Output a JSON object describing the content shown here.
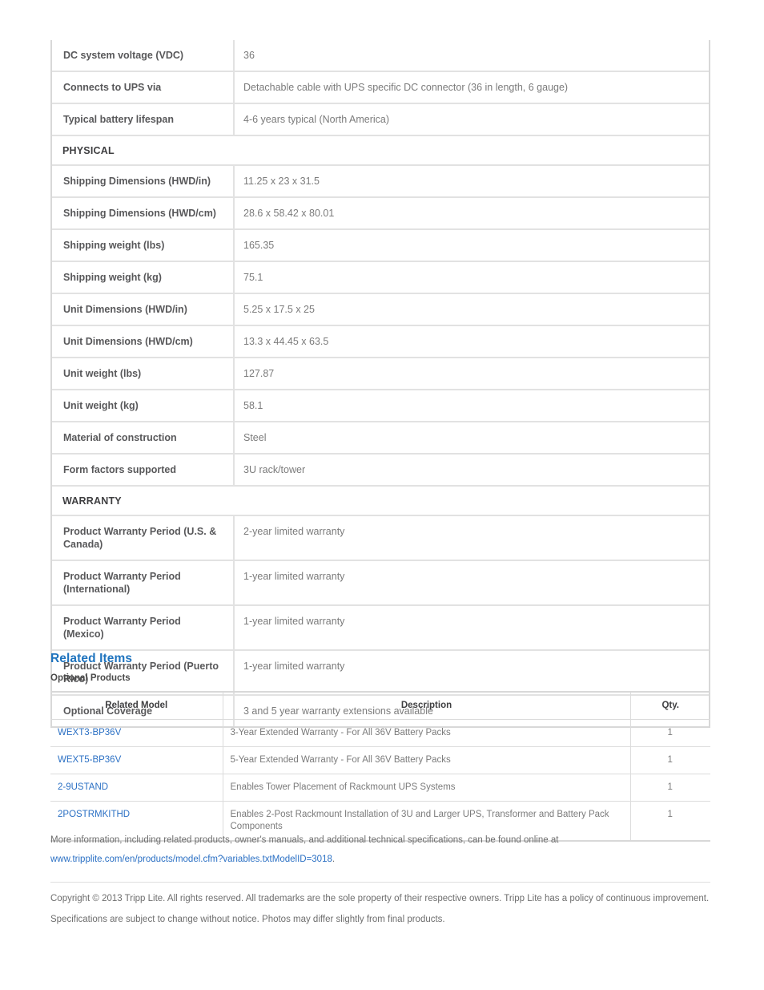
{
  "spec_table": {
    "rows": [
      {
        "type": "row",
        "key": "DC system voltage (VDC)",
        "value": "36"
      },
      {
        "type": "row",
        "key": "Connects to UPS via",
        "value": "Detachable cable with UPS specific DC connector (36 in length, 6 gauge)"
      },
      {
        "type": "row",
        "key": "Typical battery lifespan",
        "value": "4-6 years typical (North America)"
      },
      {
        "type": "section",
        "key": "PHYSICAL",
        "value": ""
      },
      {
        "type": "row",
        "key": "Shipping Dimensions (HWD/in)",
        "value": "11.25 x 23 x 31.5"
      },
      {
        "type": "row",
        "key": "Shipping Dimensions (HWD/cm)",
        "value": "28.6 x 58.42 x 80.01"
      },
      {
        "type": "row",
        "key": "Shipping weight (lbs)",
        "value": "165.35"
      },
      {
        "type": "row",
        "key": "Shipping weight (kg)",
        "value": "75.1"
      },
      {
        "type": "row",
        "key": "Unit Dimensions (HWD/in)",
        "value": "5.25 x 17.5 x 25"
      },
      {
        "type": "row",
        "key": "Unit Dimensions (HWD/cm)",
        "value": "13.3 x 44.45 x 63.5"
      },
      {
        "type": "row",
        "key": "Unit weight (lbs)",
        "value": "127.87"
      },
      {
        "type": "row",
        "key": "Unit weight (kg)",
        "value": "58.1"
      },
      {
        "type": "row",
        "key": "Material of construction",
        "value": "Steel"
      },
      {
        "type": "row",
        "key": "Form factors supported",
        "value": "3U rack/tower"
      },
      {
        "type": "section",
        "key": "WARRANTY",
        "value": ""
      },
      {
        "type": "row",
        "key": "Product Warranty Period (U.S. & Canada)",
        "value": "2-year limited warranty"
      },
      {
        "type": "row",
        "key": "Product Warranty Period (International)",
        "value": "1-year limited warranty"
      },
      {
        "type": "row",
        "key": "Product Warranty Period (Mexico)",
        "value": "1-year limited warranty"
      },
      {
        "type": "row",
        "key": "Product Warranty Period (Puerto Rico)",
        "value": "1-year limited warranty"
      },
      {
        "type": "row",
        "key": "Optional Coverage",
        "value": "3 and 5 year warranty extensions available"
      }
    ]
  },
  "related": {
    "heading": "Related Items",
    "subheading": "Optional Products",
    "columns": [
      "Related Model",
      "Description",
      "Qty."
    ],
    "rows": [
      {
        "model": "WEXT3-BP36V",
        "description": "3-Year Extended Warranty - For All 36V Battery Packs",
        "qty": "1"
      },
      {
        "model": "WEXT5-BP36V",
        "description": "5-Year Extended Warranty - For All 36V Battery Packs",
        "qty": "1"
      },
      {
        "model": "2-9USTAND",
        "description": "Enables Tower Placement of Rackmount UPS Systems",
        "qty": "1"
      },
      {
        "model": "2POSTRMKITHD",
        "description": "Enables 2-Post Rackmount Installation of 3U and Larger UPS, Transformer and Battery Pack Components",
        "qty": "1"
      }
    ]
  },
  "footer": {
    "more_info_text": "More information, including related products, owner's manuals, and additional technical specifications, can be found online at",
    "more_info_link": "www.tripplite.com/en/products/model.cfm?variables.txtModelID=3018",
    "more_info_period": ".",
    "copyright": "Copyright © 2013 Tripp Lite. All rights reserved. All trademarks are the sole property of their respective owners. Tripp Lite has a policy of continuous improvement. Specifications are subject to change without notice. Photos may differ slightly from final products."
  },
  "colors": {
    "link": "#2b70c4",
    "heading": "#1e73be",
    "key_text": "#58585a",
    "value_text": "#7b7b7b",
    "border": "#e2e2e2",
    "outer_border": "#d8d8d8"
  }
}
